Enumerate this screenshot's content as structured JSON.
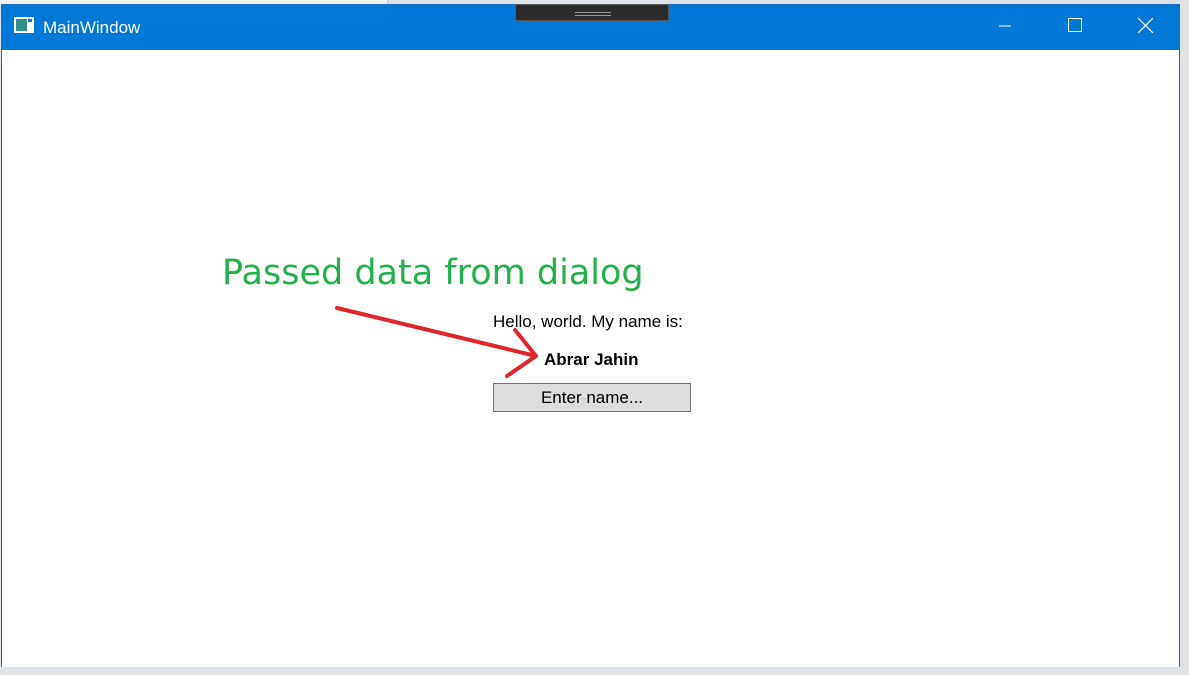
{
  "window": {
    "title": "MainWindow",
    "caption_buttons": {
      "minimize_icon": "minimize-icon",
      "maximize_icon": "maximize-icon",
      "close_icon": "close-icon"
    }
  },
  "main": {
    "annotation_text": "Passed data from dialog",
    "greeting_text": "Hello, world. My name is:",
    "name_value": "Abrar Jahin",
    "enter_button_label": "Enter name..."
  },
  "colors": {
    "titlebar": "#0078d7",
    "annotation": "#22b14c",
    "arrow": "#e0242c"
  }
}
